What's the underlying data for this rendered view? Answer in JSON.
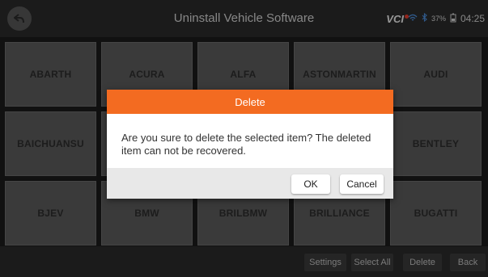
{
  "header": {
    "title": "Uninstall Vehicle Software",
    "vci_label": "VCI",
    "battery_percent": "37%",
    "time": "04:25",
    "back_icon": "back-arrow-icon",
    "wifi_icon": "wifi-icon",
    "bluetooth_icon": "bluetooth-icon",
    "battery_icon": "battery-icon"
  },
  "brands": [
    "ABARTH",
    "ACURA",
    "ALFA",
    "ASTONMARTIN",
    "AUDI",
    "BAICHUANSU",
    "",
    "",
    "",
    "BENTLEY",
    "BJEV",
    "BMW",
    "BRILBMW",
    "BRILLIANCE",
    "BUGATTI"
  ],
  "footer": {
    "settings": "Settings",
    "select_all": "Select All",
    "delete": "Delete",
    "back": "Back"
  },
  "dialog": {
    "title": "Delete",
    "message": "Are you sure to delete the selected item? The deleted item can not be recovered.",
    "ok": "OK",
    "cancel": "Cancel"
  },
  "colors": {
    "accent": "#f36b21",
    "background": "#1b1b1b",
    "tile": "#5a5a5a"
  }
}
